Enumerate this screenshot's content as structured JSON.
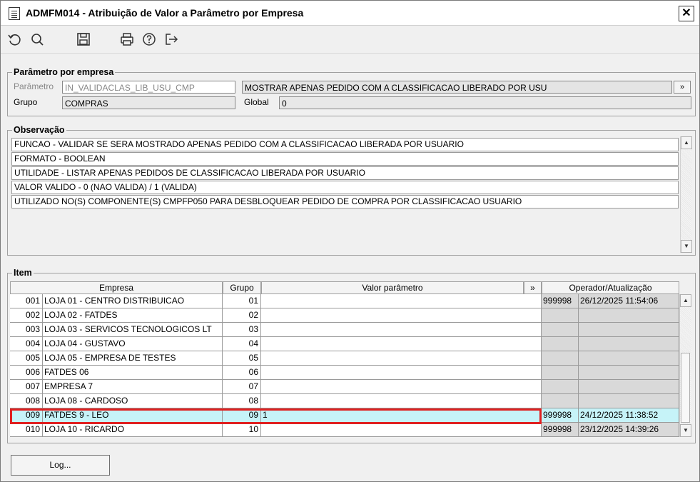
{
  "window": {
    "title": "ADMFM014 - Atribuição de Valor a Parâmetro por Empresa",
    "close_glyph": "✕"
  },
  "toolbar": {
    "buttons": [
      "refresh-icon",
      "search-icon",
      "save-icon",
      "print-icon",
      "help-icon",
      "exit-icon"
    ]
  },
  "parametro_group": {
    "legend": "Parâmetro por empresa",
    "parametro_label": "Parâmetro",
    "parametro_value": "IN_VALIDACLAS_LIB_USU_CMP",
    "descricao_value": "MOSTRAR APENAS PEDIDO COM A CLASSIFICACAO LIBERADO POR USU",
    "more_label": "»",
    "grupo_label": "Grupo",
    "grupo_value": "COMPRAS",
    "global_label": "Global",
    "global_value": "0"
  },
  "observacao": {
    "legend": "Observação",
    "lines": [
      "FUNCAO - VALIDAR SE SERA MOSTRADO APENAS PEDIDO COM A CLASSIFICACAO LIBERADA POR USUARIO",
      "FORMATO - BOOLEAN",
      "UTILIDADE - LISTAR APENAS PEDIDOS DE CLASSIFICACAO LIBERADA POR USUARIO",
      "VALOR VALIDO - 0 (NAO VALIDA)  / 1 (VALIDA)",
      "UTILIZADO NO(S) COMPONENTE(S) CMPFP050 PARA  DESBLOQUEAR PEDIDO DE COMPRA POR CLASSIFICACAO USUARIO"
    ]
  },
  "item": {
    "legend": "Item",
    "headers": {
      "empresa": "Empresa",
      "grupo": "Grupo",
      "valor": "Valor parâmetro",
      "more": "»",
      "operador": "Operador/Atualização"
    },
    "rows": [
      {
        "code": "001",
        "empresa": "LOJA 01 - CENTRO DISTRIBUICAO",
        "grupo": "01",
        "valor": "",
        "operador": "999998",
        "atualizacao": "26/12/2025 11:54:06",
        "selected": false
      },
      {
        "code": "002",
        "empresa": "LOJA 02 - FATDES",
        "grupo": "02",
        "valor": "",
        "operador": "",
        "atualizacao": "",
        "selected": false
      },
      {
        "code": "003",
        "empresa": "LOJA 03 - SERVICOS TECNOLOGICOS LT",
        "grupo": "03",
        "valor": "",
        "operador": "",
        "atualizacao": "",
        "selected": false
      },
      {
        "code": "004",
        "empresa": "LOJA 04 - GUSTAVO",
        "grupo": "04",
        "valor": "",
        "operador": "",
        "atualizacao": "",
        "selected": false
      },
      {
        "code": "005",
        "empresa": "LOJA 05 - EMPRESA DE TESTES",
        "grupo": "05",
        "valor": "",
        "operador": "",
        "atualizacao": "",
        "selected": false
      },
      {
        "code": "006",
        "empresa": "FATDES 06",
        "grupo": "06",
        "valor": "",
        "operador": "",
        "atualizacao": "",
        "selected": false
      },
      {
        "code": "007",
        "empresa": "EMPRESA 7",
        "grupo": "07",
        "valor": "",
        "operador": "",
        "atualizacao": "",
        "selected": false
      },
      {
        "code": "008",
        "empresa": "LOJA 08 - CARDOSO",
        "grupo": "08",
        "valor": "",
        "operador": "",
        "atualizacao": "",
        "selected": false
      },
      {
        "code": "009",
        "empresa": "FATDES 9 - LEO",
        "grupo": "09",
        "valor": "1",
        "operador": "999998",
        "atualizacao": "24/12/2025 11:38:52",
        "selected": true
      },
      {
        "code": "010",
        "empresa": "LOJA 10 - RICARDO",
        "grupo": "10",
        "valor": "",
        "operador": "999998",
        "atualizacao": "23/12/2025 14:39:26",
        "selected": false
      }
    ]
  },
  "footer": {
    "log_label": "Log..."
  }
}
